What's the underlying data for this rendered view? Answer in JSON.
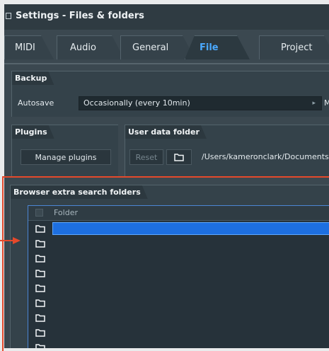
{
  "window": {
    "title": "Settings - Files & folders"
  },
  "tabs": [
    {
      "label": "MIDI",
      "active": false
    },
    {
      "label": "Audio",
      "active": false
    },
    {
      "label": "General",
      "active": false
    },
    {
      "label": "File",
      "active": true
    },
    {
      "label": "Project",
      "active": false
    }
  ],
  "backup": {
    "title": "Backup",
    "autosave_label": "Autosave",
    "autosave_value": "Occasionally (every 10min)",
    "right_label": "Ma"
  },
  "plugins": {
    "title": "Plugins",
    "manage_label": "Manage plugins"
  },
  "user_data": {
    "title": "User data folder",
    "reset_label": "Reset",
    "path": "/Users/kameronclark/Documents"
  },
  "browser": {
    "title": "Browser extra search folders",
    "column_folder": "Folder"
  },
  "colors": {
    "accent": "#4aa9ff",
    "highlight": "#e5492b",
    "selection": "#1d6fe0"
  }
}
